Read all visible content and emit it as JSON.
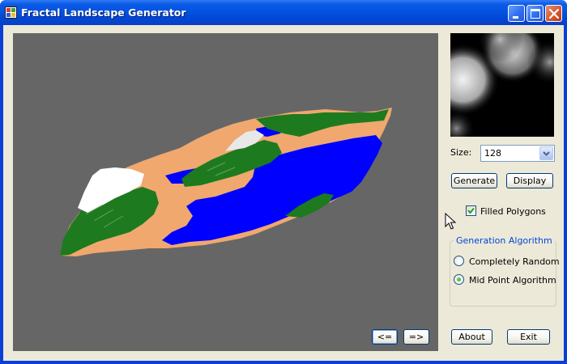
{
  "window": {
    "title": "Fractal Landscape Generator"
  },
  "titlebar": {
    "icons": [
      "app-icon",
      "minimize-icon",
      "maximize-icon",
      "close-icon"
    ]
  },
  "viewport": {
    "nav_prev_label": "<=",
    "nav_next_label": "=>",
    "colors": {
      "background": "#666666",
      "water": "#0000ff",
      "sand": "#f0a86e",
      "grass": "#1e7a1e",
      "snow": "#ffffff"
    }
  },
  "sidebar": {
    "size_label": "Size:",
    "size_value": "128",
    "generate_label": "Generate",
    "display_label": "Display",
    "filled_polygons_label": "Filled Polygons",
    "filled_polygons_checked": true,
    "group_title": "Generation Algorithm",
    "algorithms": [
      {
        "label": "Completely Random",
        "selected": false
      },
      {
        "label": "Mid Point Algorithm",
        "selected": true
      }
    ],
    "about_label": "About",
    "exit_label": "Exit"
  },
  "colors": {
    "title_bar": "#0553e2",
    "client_bg": "#ece9d8",
    "group_title": "#0046d5"
  }
}
